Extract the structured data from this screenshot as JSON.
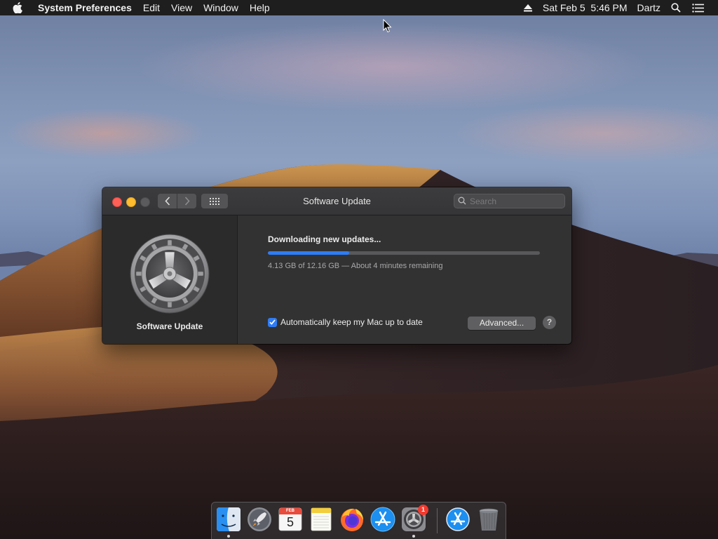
{
  "menubar": {
    "app_name": "System Preferences",
    "menus": [
      "Edit",
      "View",
      "Window",
      "Help"
    ],
    "datetime": "Sat Feb 5  5:46 PM",
    "user": "Dartz"
  },
  "window": {
    "title": "Software Update",
    "search_placeholder": "Search",
    "sidebar_label": "Software Update",
    "status_title": "Downloading new updates...",
    "progress_fraction": 0.3,
    "progress_detail": "4.13 GB of 12.16 GB — About 4 minutes remaining",
    "auto_update_label": "Automatically keep my Mac up to date",
    "auto_update_checked": true,
    "advanced_button": "Advanced...",
    "help_button": "?"
  },
  "dock": {
    "calendar_month": "FEB",
    "calendar_day": "5",
    "system_prefs_badge": "1",
    "items": [
      "finder-icon",
      "launchpad-icon",
      "calendar-icon",
      "notes-icon",
      "firefox-icon",
      "app-store-icon",
      "system-preferences-icon",
      "app-store-downloads-icon",
      "trash-icon"
    ]
  },
  "colors": {
    "accent": "#2e7cf6",
    "close": "#fe5f57",
    "minimize": "#febc2e",
    "menubar_bg": "#1e1e1f",
    "window_bg": "#323233"
  }
}
